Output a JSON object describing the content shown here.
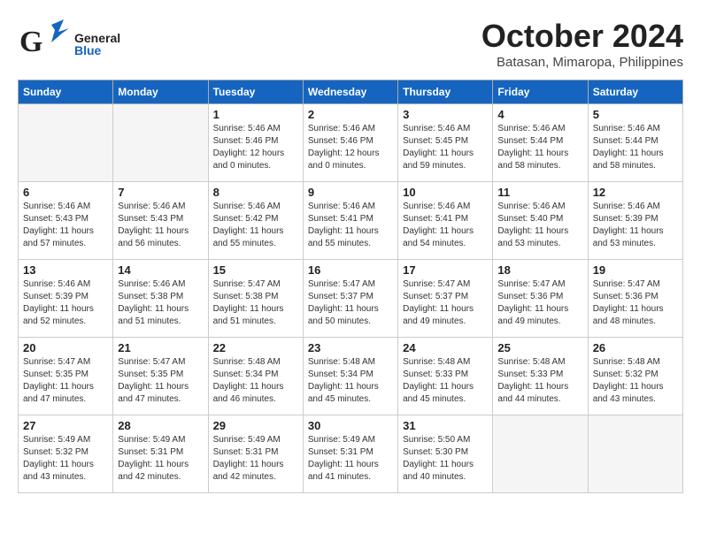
{
  "header": {
    "logo_general": "General",
    "logo_blue": "Blue",
    "month_title": "October 2024",
    "location": "Batasan, Mimaropa, Philippines"
  },
  "weekdays": [
    "Sunday",
    "Monday",
    "Tuesday",
    "Wednesday",
    "Thursday",
    "Friday",
    "Saturday"
  ],
  "weeks": [
    [
      {
        "day": "",
        "empty": true
      },
      {
        "day": "",
        "empty": true
      },
      {
        "day": "1",
        "lines": [
          "Sunrise: 5:46 AM",
          "Sunset: 5:46 PM",
          "Daylight: 12 hours",
          "and 0 minutes."
        ]
      },
      {
        "day": "2",
        "lines": [
          "Sunrise: 5:46 AM",
          "Sunset: 5:46 PM",
          "Daylight: 12 hours",
          "and 0 minutes."
        ]
      },
      {
        "day": "3",
        "lines": [
          "Sunrise: 5:46 AM",
          "Sunset: 5:45 PM",
          "Daylight: 11 hours",
          "and 59 minutes."
        ]
      },
      {
        "day": "4",
        "lines": [
          "Sunrise: 5:46 AM",
          "Sunset: 5:44 PM",
          "Daylight: 11 hours",
          "and 58 minutes."
        ]
      },
      {
        "day": "5",
        "lines": [
          "Sunrise: 5:46 AM",
          "Sunset: 5:44 PM",
          "Daylight: 11 hours",
          "and 58 minutes."
        ]
      }
    ],
    [
      {
        "day": "6",
        "lines": [
          "Sunrise: 5:46 AM",
          "Sunset: 5:43 PM",
          "Daylight: 11 hours",
          "and 57 minutes."
        ]
      },
      {
        "day": "7",
        "lines": [
          "Sunrise: 5:46 AM",
          "Sunset: 5:43 PM",
          "Daylight: 11 hours",
          "and 56 minutes."
        ]
      },
      {
        "day": "8",
        "lines": [
          "Sunrise: 5:46 AM",
          "Sunset: 5:42 PM",
          "Daylight: 11 hours",
          "and 55 minutes."
        ]
      },
      {
        "day": "9",
        "lines": [
          "Sunrise: 5:46 AM",
          "Sunset: 5:41 PM",
          "Daylight: 11 hours",
          "and 55 minutes."
        ]
      },
      {
        "day": "10",
        "lines": [
          "Sunrise: 5:46 AM",
          "Sunset: 5:41 PM",
          "Daylight: 11 hours",
          "and 54 minutes."
        ]
      },
      {
        "day": "11",
        "lines": [
          "Sunrise: 5:46 AM",
          "Sunset: 5:40 PM",
          "Daylight: 11 hours",
          "and 53 minutes."
        ]
      },
      {
        "day": "12",
        "lines": [
          "Sunrise: 5:46 AM",
          "Sunset: 5:39 PM",
          "Daylight: 11 hours",
          "and 53 minutes."
        ]
      }
    ],
    [
      {
        "day": "13",
        "lines": [
          "Sunrise: 5:46 AM",
          "Sunset: 5:39 PM",
          "Daylight: 11 hours",
          "and 52 minutes."
        ]
      },
      {
        "day": "14",
        "lines": [
          "Sunrise: 5:46 AM",
          "Sunset: 5:38 PM",
          "Daylight: 11 hours",
          "and 51 minutes."
        ]
      },
      {
        "day": "15",
        "lines": [
          "Sunrise: 5:47 AM",
          "Sunset: 5:38 PM",
          "Daylight: 11 hours",
          "and 51 minutes."
        ]
      },
      {
        "day": "16",
        "lines": [
          "Sunrise: 5:47 AM",
          "Sunset: 5:37 PM",
          "Daylight: 11 hours",
          "and 50 minutes."
        ]
      },
      {
        "day": "17",
        "lines": [
          "Sunrise: 5:47 AM",
          "Sunset: 5:37 PM",
          "Daylight: 11 hours",
          "and 49 minutes."
        ]
      },
      {
        "day": "18",
        "lines": [
          "Sunrise: 5:47 AM",
          "Sunset: 5:36 PM",
          "Daylight: 11 hours",
          "and 49 minutes."
        ]
      },
      {
        "day": "19",
        "lines": [
          "Sunrise: 5:47 AM",
          "Sunset: 5:36 PM",
          "Daylight: 11 hours",
          "and 48 minutes."
        ]
      }
    ],
    [
      {
        "day": "20",
        "lines": [
          "Sunrise: 5:47 AM",
          "Sunset: 5:35 PM",
          "Daylight: 11 hours",
          "and 47 minutes."
        ]
      },
      {
        "day": "21",
        "lines": [
          "Sunrise: 5:47 AM",
          "Sunset: 5:35 PM",
          "Daylight: 11 hours",
          "and 47 minutes."
        ]
      },
      {
        "day": "22",
        "lines": [
          "Sunrise: 5:48 AM",
          "Sunset: 5:34 PM",
          "Daylight: 11 hours",
          "and 46 minutes."
        ]
      },
      {
        "day": "23",
        "lines": [
          "Sunrise: 5:48 AM",
          "Sunset: 5:34 PM",
          "Daylight: 11 hours",
          "and 45 minutes."
        ]
      },
      {
        "day": "24",
        "lines": [
          "Sunrise: 5:48 AM",
          "Sunset: 5:33 PM",
          "Daylight: 11 hours",
          "and 45 minutes."
        ]
      },
      {
        "day": "25",
        "lines": [
          "Sunrise: 5:48 AM",
          "Sunset: 5:33 PM",
          "Daylight: 11 hours",
          "and 44 minutes."
        ]
      },
      {
        "day": "26",
        "lines": [
          "Sunrise: 5:48 AM",
          "Sunset: 5:32 PM",
          "Daylight: 11 hours",
          "and 43 minutes."
        ]
      }
    ],
    [
      {
        "day": "27",
        "lines": [
          "Sunrise: 5:49 AM",
          "Sunset: 5:32 PM",
          "Daylight: 11 hours",
          "and 43 minutes."
        ]
      },
      {
        "day": "28",
        "lines": [
          "Sunrise: 5:49 AM",
          "Sunset: 5:31 PM",
          "Daylight: 11 hours",
          "and 42 minutes."
        ]
      },
      {
        "day": "29",
        "lines": [
          "Sunrise: 5:49 AM",
          "Sunset: 5:31 PM",
          "Daylight: 11 hours",
          "and 42 minutes."
        ]
      },
      {
        "day": "30",
        "lines": [
          "Sunrise: 5:49 AM",
          "Sunset: 5:31 PM",
          "Daylight: 11 hours",
          "and 41 minutes."
        ]
      },
      {
        "day": "31",
        "lines": [
          "Sunrise: 5:50 AM",
          "Sunset: 5:30 PM",
          "Daylight: 11 hours",
          "and 40 minutes."
        ]
      },
      {
        "day": "",
        "empty": true
      },
      {
        "day": "",
        "empty": true
      }
    ]
  ]
}
